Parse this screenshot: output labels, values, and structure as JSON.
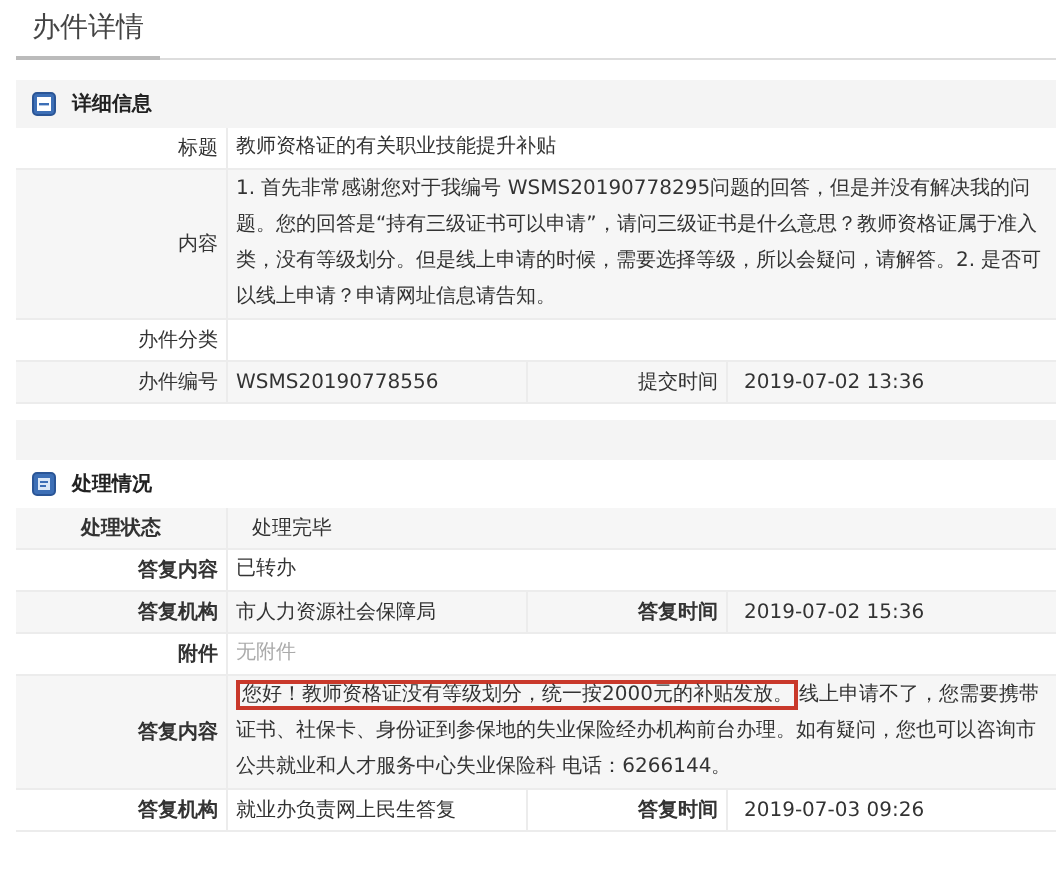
{
  "page_title": "办件详情",
  "sections": [
    {
      "kind": "details",
      "title": "详细信息",
      "rows": [
        {
          "kind": "single",
          "label": "标题",
          "value": "教师资格证的有关职业技能提升补贴"
        },
        {
          "kind": "single",
          "label": "内容",
          "value": "1. 首先非常感谢您对于我编号 WSMS20190778295问题的回答，但是并没有解决我的问题。您的回答是“持有三级证书可以申请”，请问三级证书是什么意思？教师资格证属于准入类，没有等级划分。但是线上申请的时候，需要选择等级，所以会疑问，请解答。2. 是否可以线上申请？申请网址信息请告知。"
        },
        {
          "kind": "single",
          "label": "办件分类"
        },
        {
          "kind": "pair",
          "label": "办件编号",
          "value": "WSMS20190778556",
          "label_2": "提交时间",
          "value_2": "2019-07-02 13:36"
        }
      ]
    },
    {
      "kind": "handling",
      "title": "处理情况",
      "rows": [
        {
          "kind": "status",
          "label": "处理状态",
          "value": "处理完毕"
        },
        {
          "kind": "single",
          "label": "答复内容",
          "value": "已转办"
        },
        {
          "kind": "pair",
          "label": "答复机构",
          "value": "市人力资源社会保障局",
          "label_2": "答复时间",
          "value_2": "2019-07-02 15:36"
        },
        {
          "kind": "single",
          "label": "附件",
          "value": "无附件",
          "muted": true
        },
        {
          "kind": "reply",
          "label": "答复内容",
          "highlight": "您好！教师资格证没有等级划分，统一按2000元的补贴发放。",
          "value": "线上申请不了，您需要携带证书、社保卡、身份证到参保地的失业保险经办机构前台办理。如有疑问，您也可以咨询市公共就业和人才服务中心失业保险科 电话：6266144。"
        },
        {
          "kind": "pair",
          "label": "答复机构",
          "value": "就业办负责网上民生答复",
          "label_2": "答复时间",
          "value_2": "2019-07-03 09:26"
        }
      ]
    }
  ]
}
